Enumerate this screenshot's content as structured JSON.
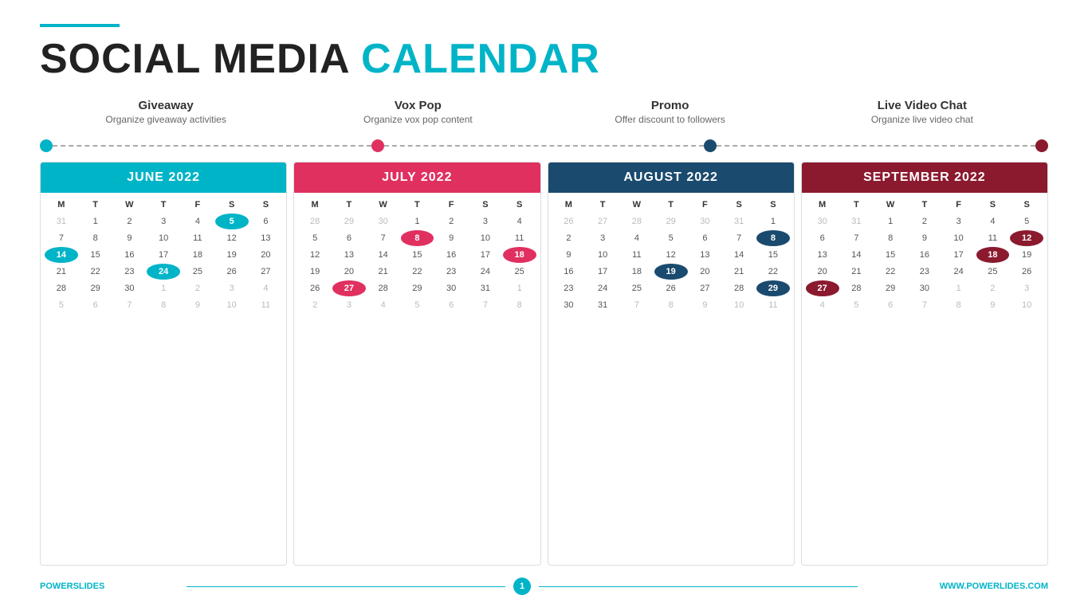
{
  "title": {
    "part1": "SOCIAL MEDIA ",
    "part2": "CALENDAR"
  },
  "categories": [
    {
      "id": "giveaway",
      "title": "Giveaway",
      "subtitle": "Organize giveaway activities",
      "dot_color": "blue"
    },
    {
      "id": "voxpop",
      "title": "Vox Pop",
      "subtitle": "Organize vox pop content",
      "dot_color": "red"
    },
    {
      "id": "promo",
      "title": "Promo",
      "subtitle": "Offer discount to followers",
      "dot_color": "darkblue"
    },
    {
      "id": "livevideochat",
      "title": "Live Video Chat",
      "subtitle": "Organize live video chat",
      "dot_color": "darkred"
    }
  ],
  "calendars": [
    {
      "id": "june",
      "name": "JUNE 2022",
      "color_class": "cal-june",
      "days_header": [
        "M",
        "T",
        "W",
        "T",
        "F",
        "S",
        "S"
      ],
      "weeks": [
        [
          "31",
          "1",
          "2",
          "3",
          "4",
          "5",
          "6"
        ],
        [
          "7",
          "8",
          "9",
          "10",
          "11",
          "12",
          "13"
        ],
        [
          "14",
          "15",
          "16",
          "17",
          "18",
          "19",
          "20"
        ],
        [
          "21",
          "22",
          "23",
          "24",
          "25",
          "26",
          "27"
        ],
        [
          "28",
          "29",
          "30",
          "1",
          "2",
          "3",
          "4"
        ],
        [
          "5",
          "6",
          "7",
          "8",
          "9",
          "10",
          "11"
        ]
      ],
      "other_month": [
        "31",
        "1",
        "2",
        "3",
        "4",
        "5",
        "6",
        "7",
        "8",
        "9",
        "10",
        "11"
      ],
      "highlights": {
        "blue": [
          "5",
          "14",
          "24"
        ],
        "red": [],
        "darkblue": [],
        "darkred": []
      }
    },
    {
      "id": "july",
      "name": "JULY 2022",
      "color_class": "cal-july",
      "days_header": [
        "M",
        "T",
        "W",
        "T",
        "F",
        "S",
        "S"
      ],
      "weeks": [
        [
          "28",
          "29",
          "30",
          "1",
          "2",
          "3",
          "4"
        ],
        [
          "5",
          "6",
          "7",
          "8",
          "9",
          "10",
          "11"
        ],
        [
          "12",
          "13",
          "14",
          "15",
          "16",
          "17",
          "18"
        ],
        [
          "19",
          "20",
          "21",
          "22",
          "23",
          "24",
          "25"
        ],
        [
          "26",
          "27",
          "28",
          "29",
          "30",
          "31",
          "1"
        ],
        [
          "2",
          "3",
          "4",
          "5",
          "6",
          "7",
          "8"
        ]
      ],
      "other_month_start": [
        "28",
        "29",
        "30"
      ],
      "other_month_end": [
        "1",
        "2",
        "3",
        "4",
        "5",
        "6",
        "7",
        "8"
      ],
      "highlights": {
        "blue": [],
        "red": [
          "8",
          "18",
          "27"
        ],
        "darkblue": [],
        "darkred": []
      }
    },
    {
      "id": "august",
      "name": "AUGUST 2022",
      "color_class": "cal-august",
      "days_header": [
        "M",
        "T",
        "W",
        "T",
        "F",
        "S",
        "S"
      ],
      "weeks": [
        [
          "26",
          "27",
          "28",
          "29",
          "30",
          "31",
          "1"
        ],
        [
          "2",
          "3",
          "4",
          "5",
          "6",
          "7",
          "8"
        ],
        [
          "9",
          "10",
          "11",
          "12",
          "13",
          "14",
          "15"
        ],
        [
          "16",
          "17",
          "18",
          "19",
          "20",
          "21",
          "22"
        ],
        [
          "23",
          "24",
          "25",
          "26",
          "27",
          "28",
          "29"
        ],
        [
          "30",
          "31",
          "7",
          "8",
          "9",
          "10",
          "11"
        ]
      ],
      "highlights": {
        "blue": [],
        "red": [],
        "darkblue": [
          "8",
          "19",
          "29"
        ],
        "darkred": []
      }
    },
    {
      "id": "september",
      "name": "SEPTEMBER 2022",
      "color_class": "cal-september",
      "days_header": [
        "M",
        "T",
        "W",
        "T",
        "F",
        "S",
        "S"
      ],
      "weeks": [
        [
          "30",
          "31",
          "1",
          "2",
          "3",
          "4",
          "5"
        ],
        [
          "6",
          "7",
          "8",
          "9",
          "10",
          "11",
          "12"
        ],
        [
          "13",
          "14",
          "15",
          "16",
          "17",
          "18",
          "19"
        ],
        [
          "20",
          "21",
          "22",
          "23",
          "24",
          "25",
          "26"
        ],
        [
          "27",
          "28",
          "29",
          "30",
          "1",
          "2",
          "3"
        ],
        [
          "4",
          "5",
          "6",
          "7",
          "8",
          "9",
          "10"
        ]
      ],
      "highlights": {
        "blue": [],
        "red": [],
        "darkblue": [],
        "darkred": [
          "12",
          "18",
          "27"
        ]
      }
    }
  ],
  "footer": {
    "left_part1": "POWER",
    "left_part2": "SLIDES",
    "page_num": "1",
    "right": "WWW.POWERLIDES.COM"
  }
}
